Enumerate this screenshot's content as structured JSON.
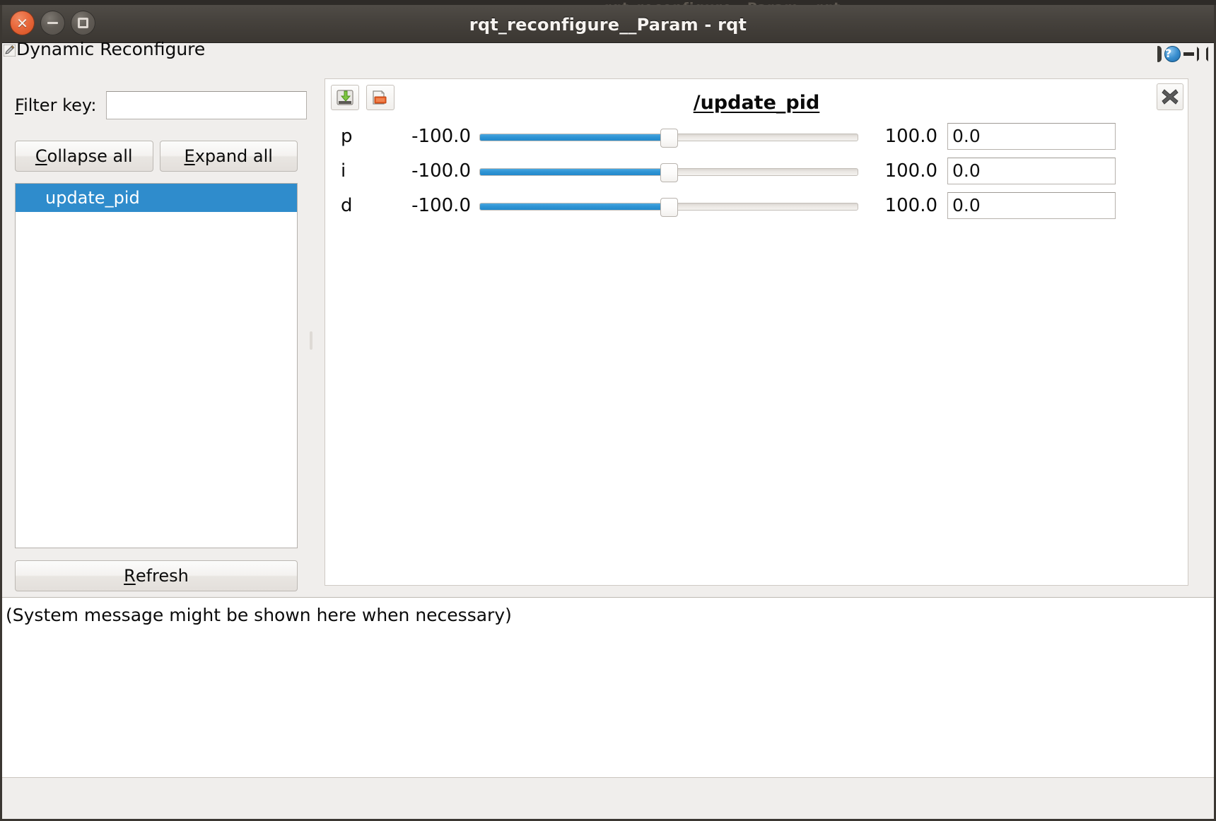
{
  "desktop": {
    "ghost_text": "rqt_reconfigure__Param - rqt"
  },
  "window": {
    "title": "rqt_reconfigure__Param - rqt",
    "controls": {
      "close_label": "×",
      "minimize_label": "minimize",
      "maximize_label": "maximize"
    }
  },
  "dock": {
    "title": "Dynamic Reconfigure",
    "pencil_icon": "pencil-icon",
    "float_icon": "undock-icon",
    "help_icon": "?",
    "minimize_icon": "minimize-icon",
    "close_icon": "close-icon"
  },
  "sidebar": {
    "filter": {
      "label_prefix": "F",
      "label_rest": "ilter key:",
      "value": "",
      "placeholder": ""
    },
    "buttons": {
      "collapse_prefix": "C",
      "collapse_rest": "ollapse all",
      "expand_prefix": "E",
      "expand_rest": "xpand all",
      "refresh_prefix": "R",
      "refresh_rest": "efresh"
    },
    "nodes": [
      {
        "label": "update_pid",
        "selected": true
      }
    ]
  },
  "param_panel": {
    "title": "/update_pid",
    "toolbar": {
      "save_icon": "save-to-disk-icon",
      "load_icon": "open-file-icon"
    },
    "close_icon": "close-x-icon",
    "rows": [
      {
        "name": "p",
        "min": "-100.0",
        "max": "100.0",
        "value": "0.0",
        "fill_percent": 50
      },
      {
        "name": "i",
        "min": "-100.0",
        "max": "100.0",
        "value": "0.0",
        "fill_percent": 50
      },
      {
        "name": "d",
        "min": "-100.0",
        "max": "100.0",
        "value": "0.0",
        "fill_percent": 50
      }
    ]
  },
  "status": {
    "message": "(System message might be shown here when necessary)"
  },
  "colors": {
    "accent_blue": "#2f8ccc",
    "slider_blue": "#2e94d4",
    "titlebar": "#45413c",
    "window_bg": "#f0eeec",
    "close_orange": "#e8683c"
  }
}
